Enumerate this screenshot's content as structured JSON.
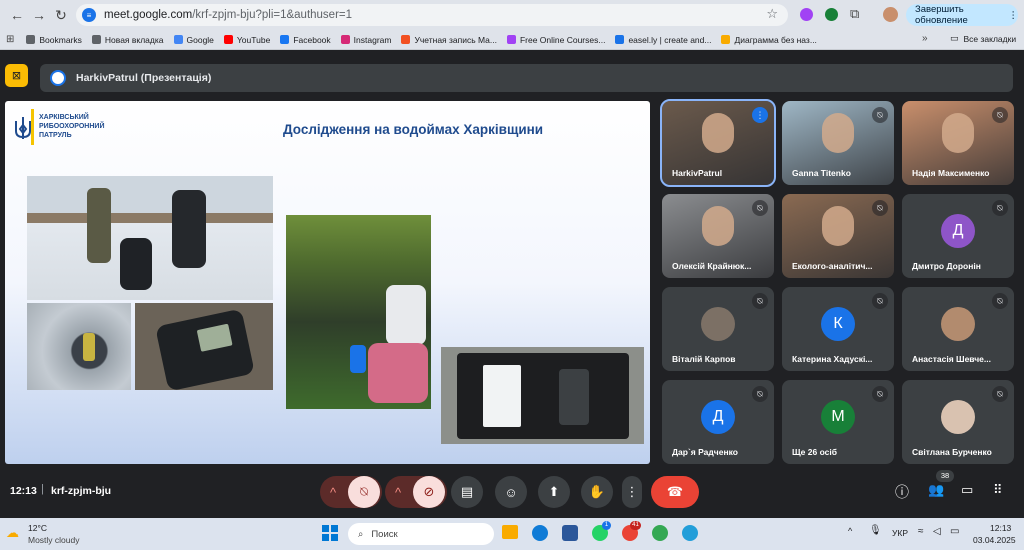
{
  "browser": {
    "url_host": "meet.google.com",
    "url_path": "/krf-zpjm-bju?pli=1&authuser=1",
    "update_label": "Завершить обновление",
    "bookmarks": [
      {
        "label": "Bookmarks",
        "icon": "star-icon",
        "color": "#5f6368"
      },
      {
        "label": "Новая вкладка",
        "icon": "globe-icon",
        "color": "#5f6368"
      },
      {
        "label": "Google",
        "icon": "google-icon",
        "color": "#4285f4"
      },
      {
        "label": "YouTube",
        "icon": "youtube-icon",
        "color": "#ff0000"
      },
      {
        "label": "Facebook",
        "icon": "facebook-icon",
        "color": "#1877f2"
      },
      {
        "label": "Instagram",
        "icon": "instagram-icon",
        "color": "#d62976"
      },
      {
        "label": "Учетная запись Ma...",
        "icon": "microsoft-icon",
        "color": "#f25022"
      },
      {
        "label": "Free Online Courses...",
        "icon": "courses-icon",
        "color": "#a142f4"
      },
      {
        "label": "easel.ly | create and...",
        "icon": "easelly-icon",
        "color": "#1a73e8"
      },
      {
        "label": "Диаграмма без наз...",
        "icon": "diagram-icon",
        "color": "#f9ab00"
      }
    ],
    "all_bookmarks": "Все закладки"
  },
  "meeting": {
    "presenter_title": "HarkivPatrul (Презентація)",
    "code": "krf-zpjm-bju",
    "time": "12:13",
    "people_count": "38"
  },
  "slide": {
    "org_name": "ХАРКІВСЬКИЙ РИБООХОРОННИЙ ПАТРУЛЬ",
    "title": "Дослідження на водоймах Харківщини"
  },
  "participants": [
    {
      "name": "HarkivPatrul",
      "avatar": "",
      "color": "#6b5a4c",
      "video": true,
      "active": true,
      "mic": "speaking"
    },
    {
      "name": "Ganna Titenko",
      "avatar": "",
      "color": "#9fb7c6",
      "video": true,
      "mic": "muted"
    },
    {
      "name": "Надія Максименко",
      "avatar": "",
      "color": "#c98f6c",
      "video": true,
      "mic": "muted"
    },
    {
      "name": "Олексій Крайнюк...",
      "avatar": "",
      "color": "#8b8d90",
      "video": true,
      "mic": "muted"
    },
    {
      "name": "Еколого-аналітич...",
      "avatar": "",
      "color": "#8a6a52",
      "video": true,
      "mic": "muted"
    },
    {
      "name": "Дмитро Доронін",
      "avatar": "Д",
      "color": "#8e55c8",
      "video": false,
      "mic": "muted"
    },
    {
      "name": "Віталій Карпов",
      "avatar": "",
      "color": "#7c7065",
      "video": false,
      "photo": true,
      "mic": "muted"
    },
    {
      "name": "Катерина Хадускі...",
      "avatar": "К",
      "color": "#1a73e8",
      "video": false,
      "mic": "muted"
    },
    {
      "name": "Анастасія Шевче...",
      "avatar": "",
      "color": "#b28b6e",
      "video": false,
      "photo": true,
      "mic": "muted"
    },
    {
      "name": "Дар`я Радченко",
      "avatar": "Д",
      "color": "#1a73e8",
      "video": false,
      "mic": "muted"
    },
    {
      "name": "Ще 26 осіб",
      "avatar": "М",
      "color": "#188038",
      "video": false,
      "mic": "muted"
    },
    {
      "name": "Світлана Бурченко",
      "avatar": "",
      "color": "#d9c2b0",
      "video": false,
      "photo": true,
      "mic": "muted"
    }
  ],
  "taskbar": {
    "temp": "12°C",
    "weather": "Mostly cloudy",
    "search_placeholder": "Поиск",
    "lang": "УКР",
    "clock_time": "12:13",
    "clock_date": "03.04.2025",
    "badge_1": "1",
    "badge_2": "41"
  }
}
